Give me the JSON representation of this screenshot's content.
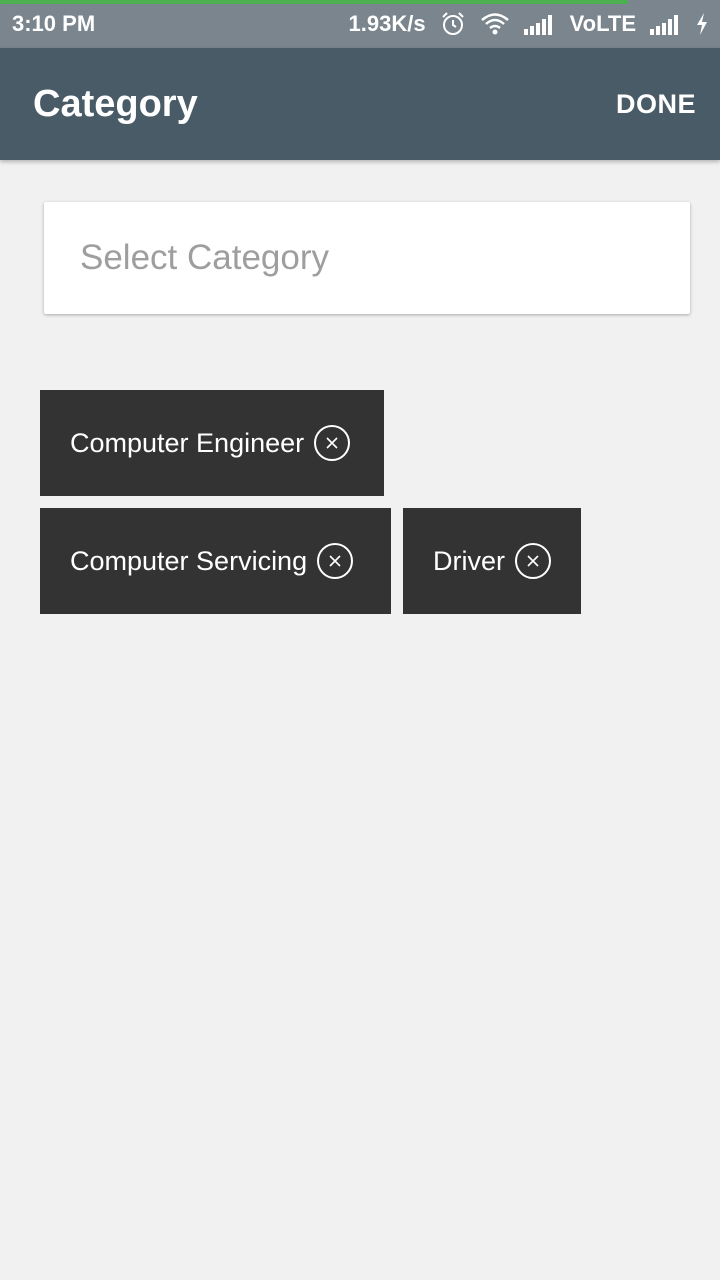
{
  "status_bar": {
    "time": "3:10 PM",
    "network_speed": "1.93K/s",
    "carrier_label": "VoLTE",
    "icons": [
      "alarm-icon",
      "wifi-icon",
      "signal-icon",
      "signal-icon",
      "charging-icon"
    ]
  },
  "app_bar": {
    "title": "Category",
    "done_label": "DONE"
  },
  "search": {
    "placeholder": "Select Category",
    "value": ""
  },
  "chips": [
    {
      "label": "Computer Engineer"
    },
    {
      "label": "Computer Servicing"
    },
    {
      "label": "Driver"
    }
  ],
  "colors": {
    "status_bar": "#7a858d",
    "app_bar": "#485b66",
    "chip": "#333333",
    "background": "#f1f1f1",
    "progress": "#4caf50"
  }
}
